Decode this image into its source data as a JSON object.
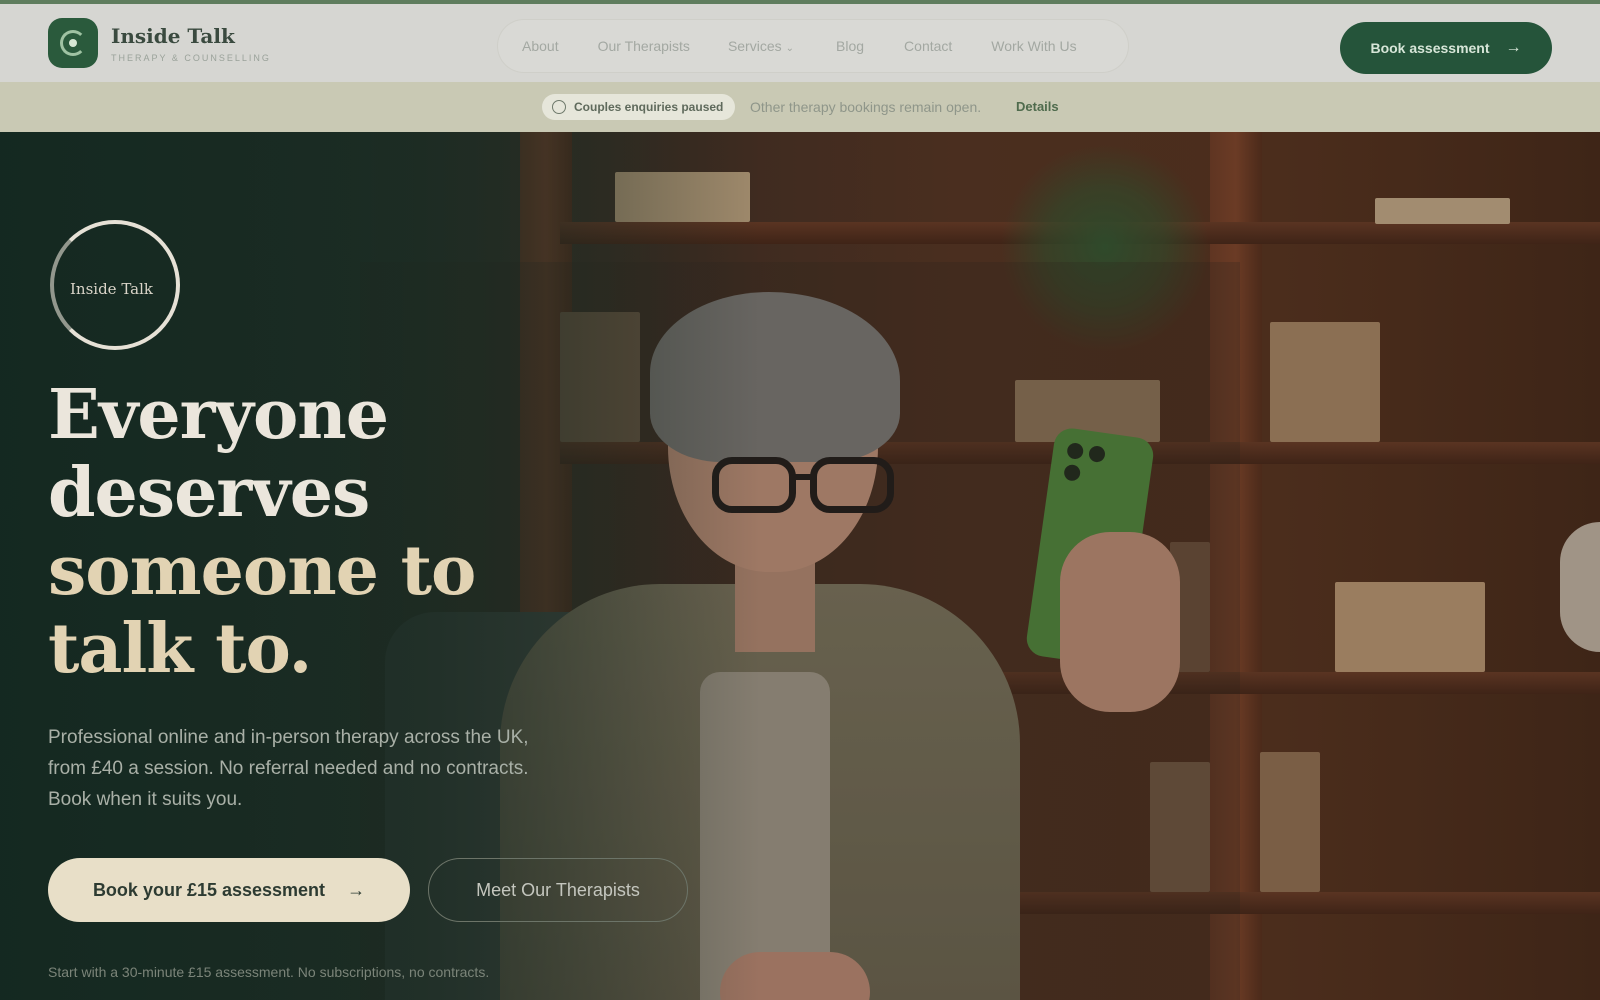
{
  "brand": {
    "name": "Inside Talk",
    "tagline": "THERAPY & COUNSELLING",
    "logo_icon": "circle-mark-icon"
  },
  "nav": {
    "items": [
      {
        "label": "About"
      },
      {
        "label": "Our Therapists"
      },
      {
        "label": "Services"
      },
      {
        "label": "Blog"
      },
      {
        "label": "Contact"
      },
      {
        "label": "Work With Us"
      }
    ],
    "services_caret_icon": "chevron-down-icon"
  },
  "header_cta": {
    "label": "Book assessment",
    "icon": "arrow-right-icon"
  },
  "notice": {
    "badge": "Couples enquiries paused",
    "badge_icon": "info-circle-icon",
    "text": "Other therapy bookings remain open.",
    "link": "Details"
  },
  "hero": {
    "emblem_text": "Inside Talk",
    "headline_lines": [
      "Everyone",
      "deserves",
      "someone to",
      "talk to."
    ],
    "subtext": "Professional online and in-person therapy across the UK, from £40 a session. No referral needed and no contracts. Book when it suits you.",
    "primary_cta": "Book your £15 assessment",
    "primary_cta_icon": "arrow-right-icon",
    "secondary_cta": "Meet Our Therapists",
    "footnote": "Start with a 30-minute £15 assessment. No subscriptions, no contracts."
  },
  "colors": {
    "brand_green": "#25543a",
    "accent_cream": "#e8dfc8",
    "notice_bg": "#c9c9b4"
  }
}
